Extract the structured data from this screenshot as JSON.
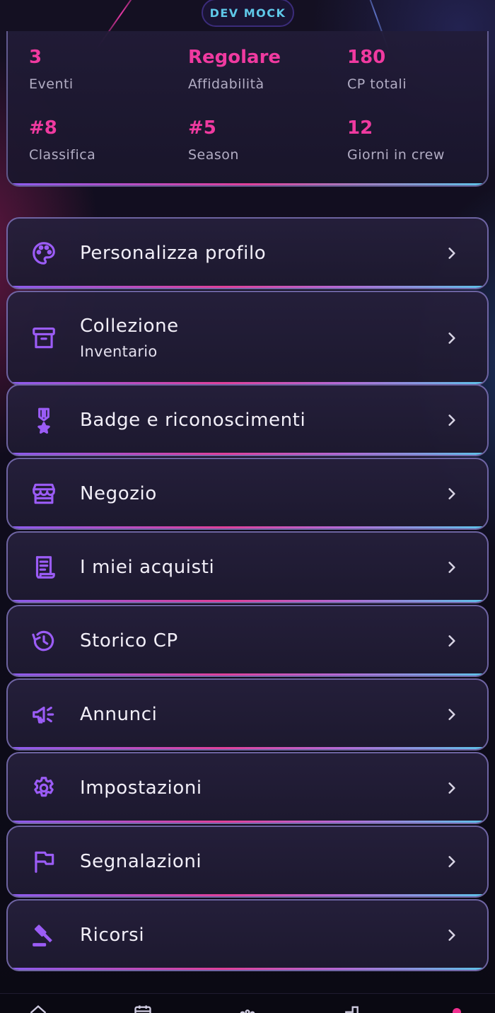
{
  "dev_badge": "DEV MOCK",
  "stats": [
    {
      "value": "3",
      "label": "Eventi"
    },
    {
      "value": "Regolare",
      "label": "Affidabilità"
    },
    {
      "value": "180",
      "label": "CP totali"
    },
    {
      "value": "#8",
      "label": "Classifica"
    },
    {
      "value": "#5",
      "label": "Season"
    },
    {
      "value": "12",
      "label": "Giorni in crew"
    }
  ],
  "menu": [
    {
      "label": "Personalizza profilo",
      "icon": "palette-icon"
    },
    {
      "label": "Collezione",
      "sublabel": "Inventario",
      "icon": "archive-icon"
    },
    {
      "label": "Badge e riconoscimenti",
      "icon": "medal-icon"
    },
    {
      "label": "Negozio",
      "icon": "store-icon"
    },
    {
      "label": "I miei acquisti",
      "icon": "receipt-icon"
    },
    {
      "label": "Storico CP",
      "icon": "history-icon"
    },
    {
      "label": "Annunci",
      "icon": "megaphone-icon"
    },
    {
      "label": "Impostazioni",
      "icon": "gear-icon"
    },
    {
      "label": "Segnalazioni",
      "icon": "flag-icon"
    },
    {
      "label": "Ricorsi",
      "icon": "gavel-icon"
    }
  ],
  "bottom_nav": [
    "home-icon",
    "calendar-icon",
    "community-icon",
    "leaderboard-icon",
    "profile-icon"
  ],
  "colors": {
    "accent_pink": "#f03aa0",
    "icon_purple": "#9b5cf6",
    "dev_text": "#5fc8e8"
  }
}
